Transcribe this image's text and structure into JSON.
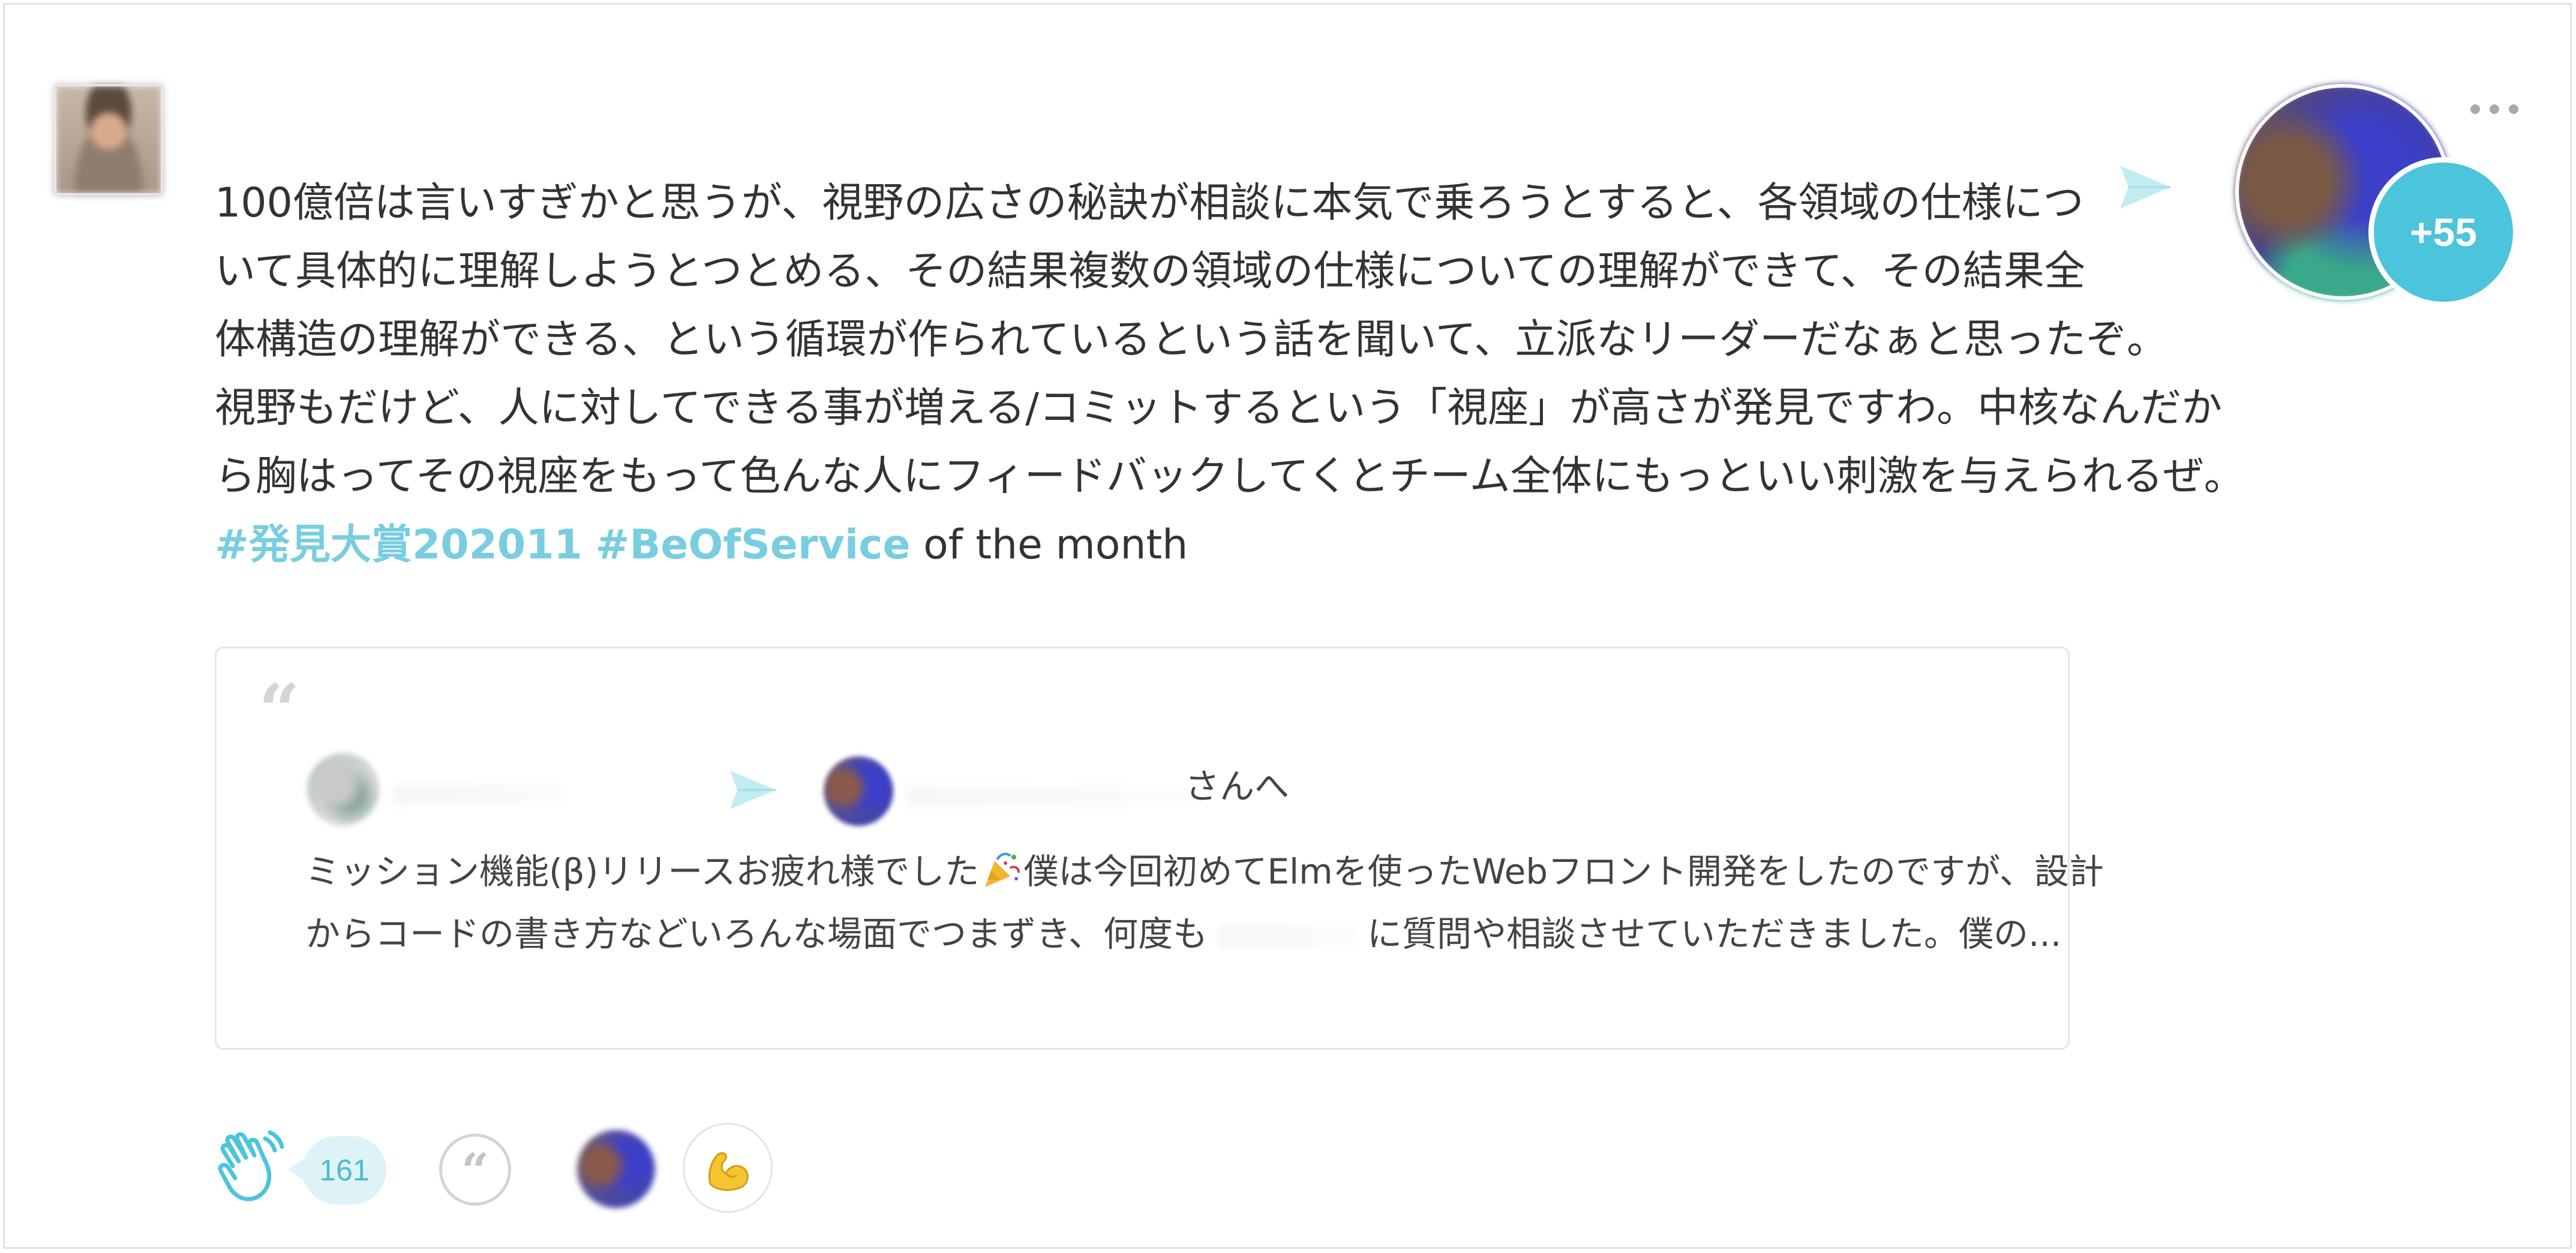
{
  "post": {
    "message_lines": [
      "100億倍は言いすぎかと思うが、視野の広さの秘訣が相談に本気で乗ろうとすると、各領域の仕様につ",
      "いて具体的に理解しようとつとめる、その結果複数の領域の仕様についての理解ができて、その結果全",
      "体構造の理解ができる、という循環が作られているという話を聞いて、立派なリーダーだなぁと思ったぞ。",
      "視野もだけど、人に対してできる事が増える/コミットするという「視座」が高さが発見ですわ。中核なんだか",
      "ら胸はってその視座をもって色んな人にフィードバックしてくとチーム全体にもっといい刺激を与えられるぜ。"
    ],
    "hashtags": [
      "#発見大賞202011",
      "#BeOfService"
    ],
    "hashtag_suffix": " of the month",
    "recipient_more_count": "+55",
    "accent_color": "#4cc4dc",
    "hashtag_color": "#78cde0"
  },
  "quote": {
    "recipient_suffix": "さんへ",
    "body_line1_a": "ミッション機能(β)リリースお疲れ様でした",
    "body_line1_emoji": "party-popper-icon",
    "body_line1_b": "僕は今回初めてElmを使ったWebフロント開発をしたのですが、設計",
    "body_line2_a": "からコードの書き方などいろんな場面でつまずき、何度も",
    "body_line2_b": "に質問や相談させていただきました。僕の..."
  },
  "footer": {
    "clap_count": "161",
    "reaction_emoji": "flexed-biceps-icon"
  }
}
